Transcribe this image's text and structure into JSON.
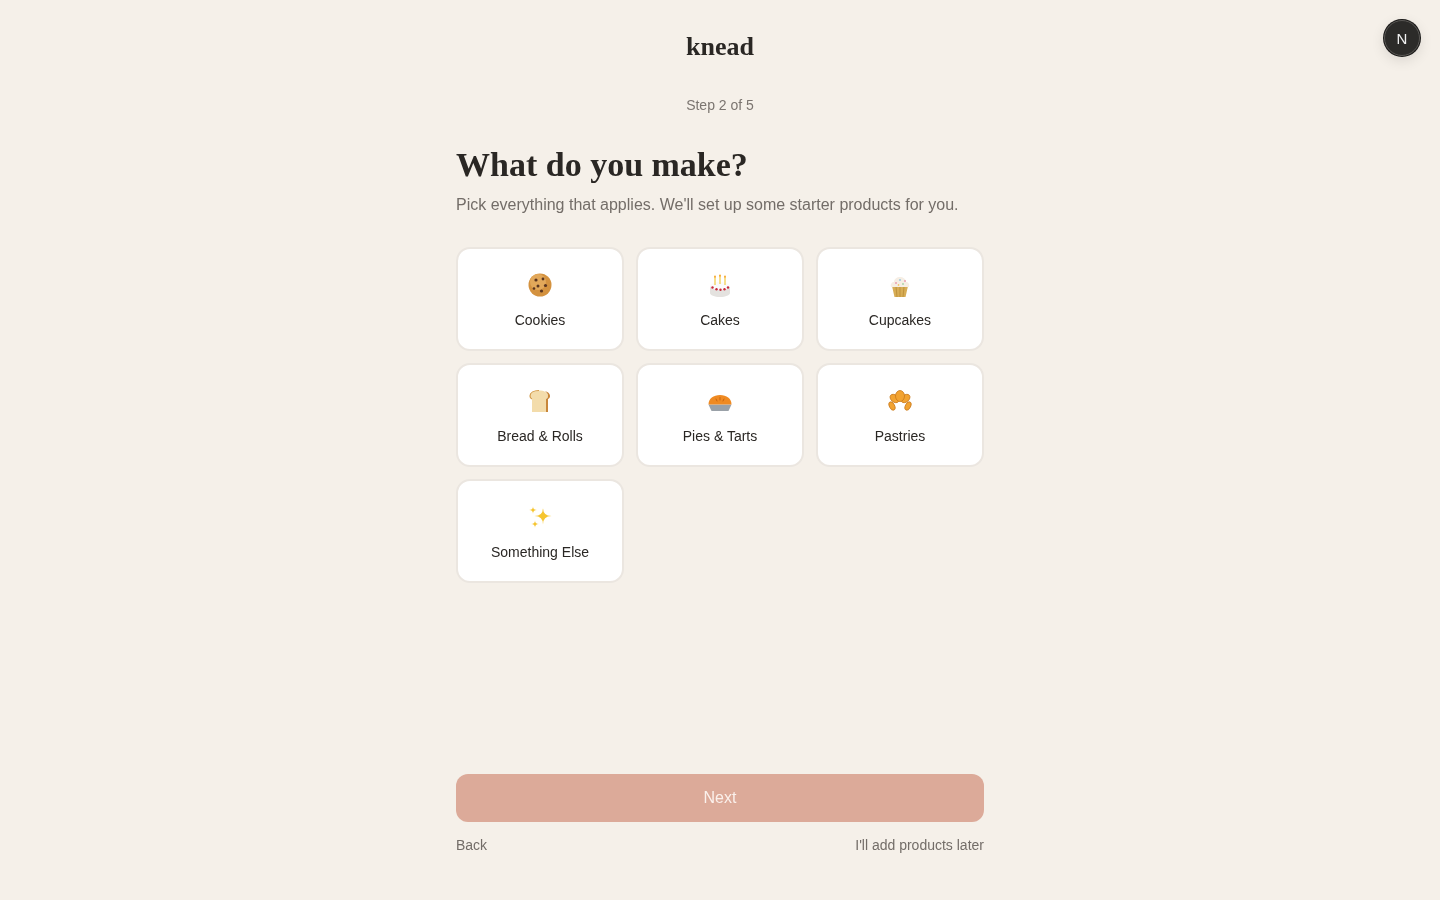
{
  "header": {
    "logo": "knead",
    "avatar": "N"
  },
  "progress": {
    "label": "Step 2 of 5"
  },
  "heading": "What do you make?",
  "subtitle": "Pick everything that applies. We'll set up some starter products for you.",
  "categories": [
    {
      "label": "Cookies",
      "selected": false
    },
    {
      "label": "Cakes",
      "selected": false
    },
    {
      "label": "Cupcakes",
      "selected": false
    },
    {
      "label": "Bread & Rolls",
      "selected": false
    },
    {
      "label": "Pies & Tarts",
      "selected": false
    },
    {
      "label": "Pastries",
      "selected": false
    },
    {
      "label": "Something Else",
      "selected": false
    }
  ],
  "next_button": {
    "label": "Next",
    "disabled": true
  },
  "footer": {
    "back": "Back",
    "skip": "I'll add products later"
  }
}
